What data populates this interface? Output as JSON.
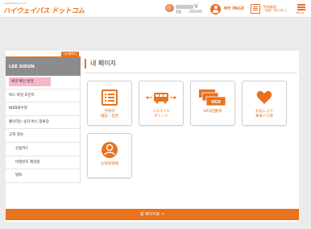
{
  "header": {
    "logo_small": "highwaybus.com",
    "logo": "ハイウェイバス ドットコム",
    "user": {
      "honor": "정중",
      "sama": "님"
    },
    "mypage_label": "MY PAGE",
    "reserve_line1": "予約確認",
    "reserve_line2": "（変更・取り消し）",
    "menu_label": "MENU"
  },
  "sidebar": {
    "top_label": "내 페이지",
    "user_name": "LEE SIEUN",
    "items": [
      {
        "label": "예약 확인 변경",
        "highlighted": true
      },
      {
        "label": "버스 마일 포인트"
      },
      {
        "label": "WEB회수권"
      },
      {
        "label": "좋아하는 승차 버스 정류장"
      },
      {
        "label": "고객 정보"
      },
      {
        "label": "신용카드",
        "sub": true
      },
      {
        "label": "비밀번호 재설정",
        "sub": true
      },
      {
        "label": "탈퇴",
        "sub": true
      }
    ]
  },
  "main": {
    "title": "내 페이지",
    "tiles": [
      {
        "line1": "予約の",
        "line2": "確認・変更",
        "icon": "list-icon"
      },
      {
        "line1": "バスマイル",
        "line2": "ポイント",
        "icon": "bus-icon"
      },
      {
        "line1": "WEB回数券",
        "line2": "",
        "icon": "ticket-icon"
      },
      {
        "line1": "お気に入り",
        "line2": "乗車バス停",
        "icon": "heart-icon"
      },
      {
        "line1": "お客様情報",
        "line2": "",
        "icon": "person-icon"
      }
    ]
  },
  "footer": {
    "label": "홈 페이지로 >"
  },
  "colors": {
    "accent": "#e8721e",
    "highlight": "#f6b7c6",
    "sidebar_name_bg": "#8c8c8c"
  }
}
